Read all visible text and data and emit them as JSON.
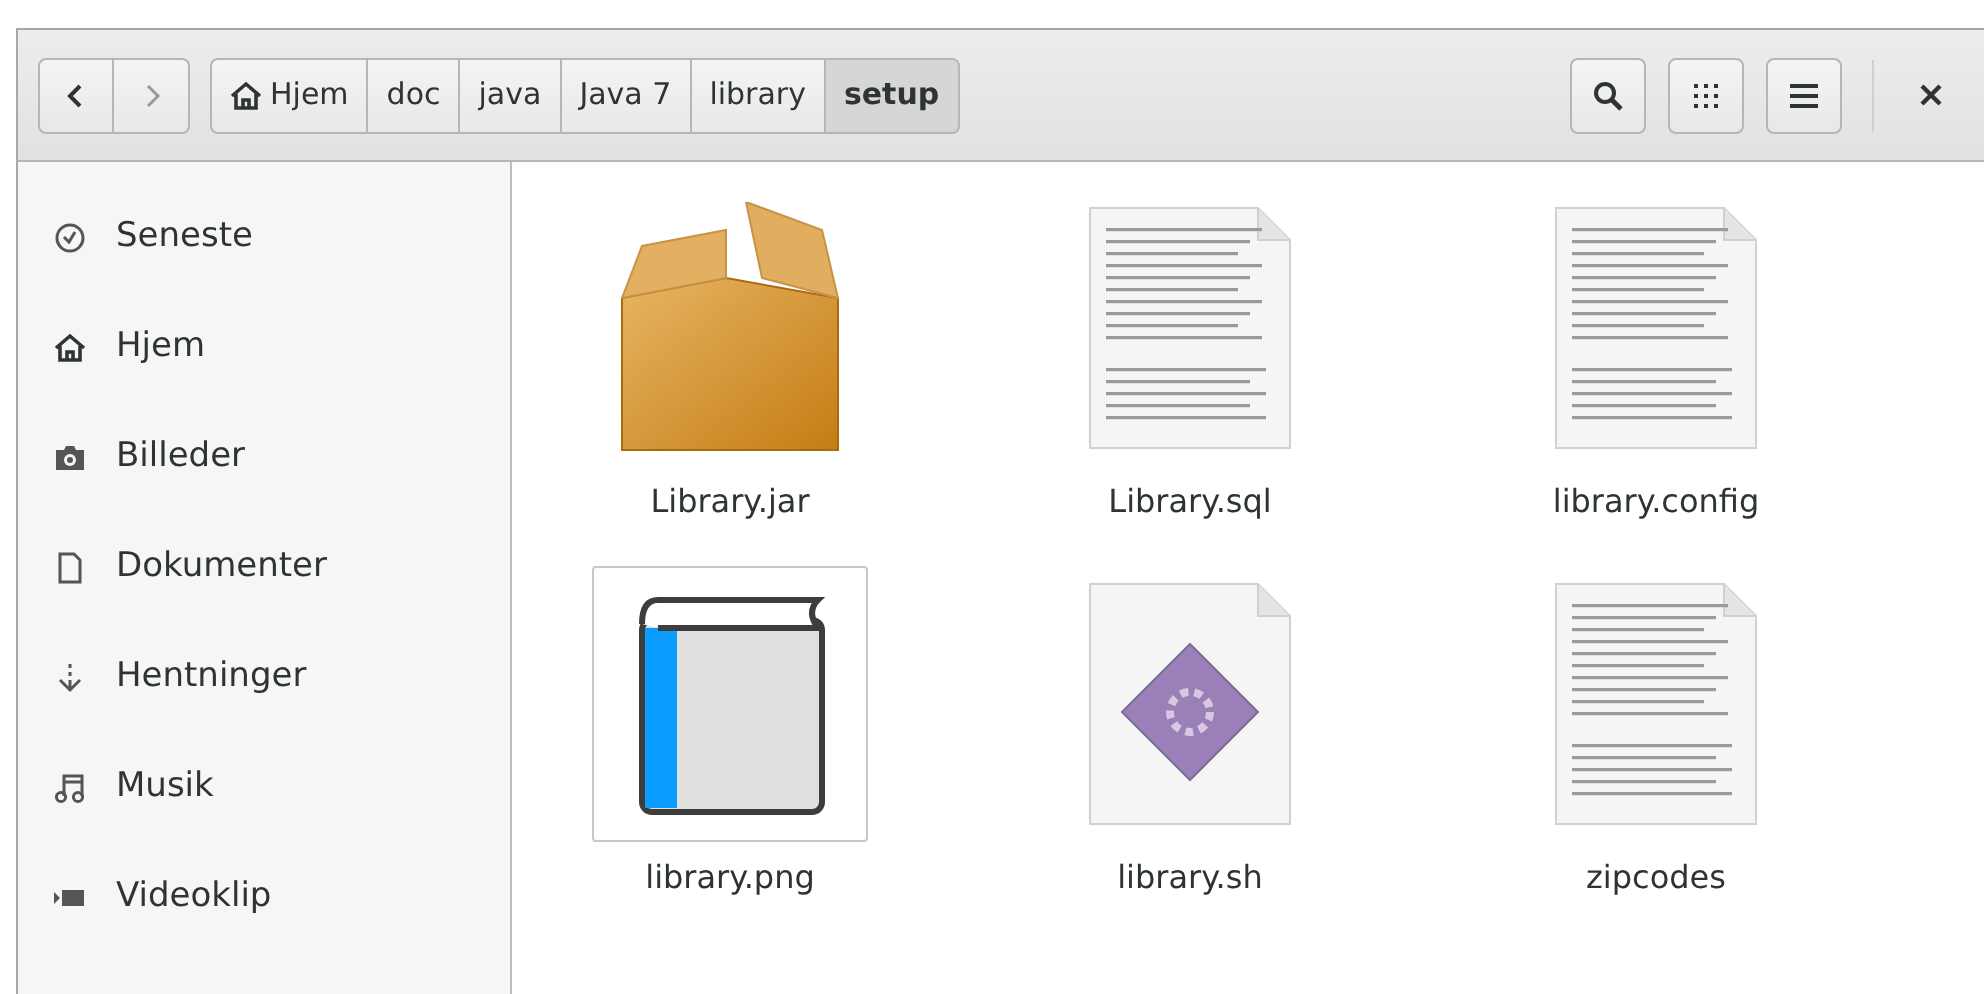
{
  "toolbar": {
    "nav": [
      {
        "kind": "back",
        "disabled": false
      },
      {
        "kind": "forward",
        "disabled": true
      }
    ],
    "path": [
      {
        "label": "Hjem",
        "kind": "home",
        "selected": false
      },
      {
        "label": "doc",
        "kind": "folder",
        "selected": false
      },
      {
        "label": "java",
        "kind": "folder",
        "selected": false
      },
      {
        "label": "Java 7",
        "kind": "folder",
        "selected": false
      },
      {
        "label": "library",
        "kind": "folder",
        "selected": false
      },
      {
        "label": "setup",
        "kind": "folder",
        "selected": true
      }
    ],
    "actions": [
      {
        "kind": "search"
      },
      {
        "kind": "grid"
      },
      {
        "kind": "menu"
      },
      {
        "kind": "close"
      }
    ]
  },
  "sidebar": {
    "items": [
      {
        "label": "Seneste",
        "kind": "recent"
      },
      {
        "label": "Hjem",
        "kind": "home"
      },
      {
        "label": "Billeder",
        "kind": "pictures"
      },
      {
        "label": "Dokumenter",
        "kind": "documents"
      },
      {
        "label": "Hentninger",
        "kind": "downloads"
      },
      {
        "label": "Musik",
        "kind": "music"
      },
      {
        "label": "Videoklip",
        "kind": "videos"
      }
    ]
  },
  "files": [
    {
      "name": "Library.jar",
      "kind": "archive"
    },
    {
      "name": "Library.sql",
      "kind": "text"
    },
    {
      "name": "library.config",
      "kind": "text"
    },
    {
      "name": "library.png",
      "kind": "image"
    },
    {
      "name": "library.sh",
      "kind": "script"
    },
    {
      "name": "zipcodes",
      "kind": "text"
    }
  ]
}
